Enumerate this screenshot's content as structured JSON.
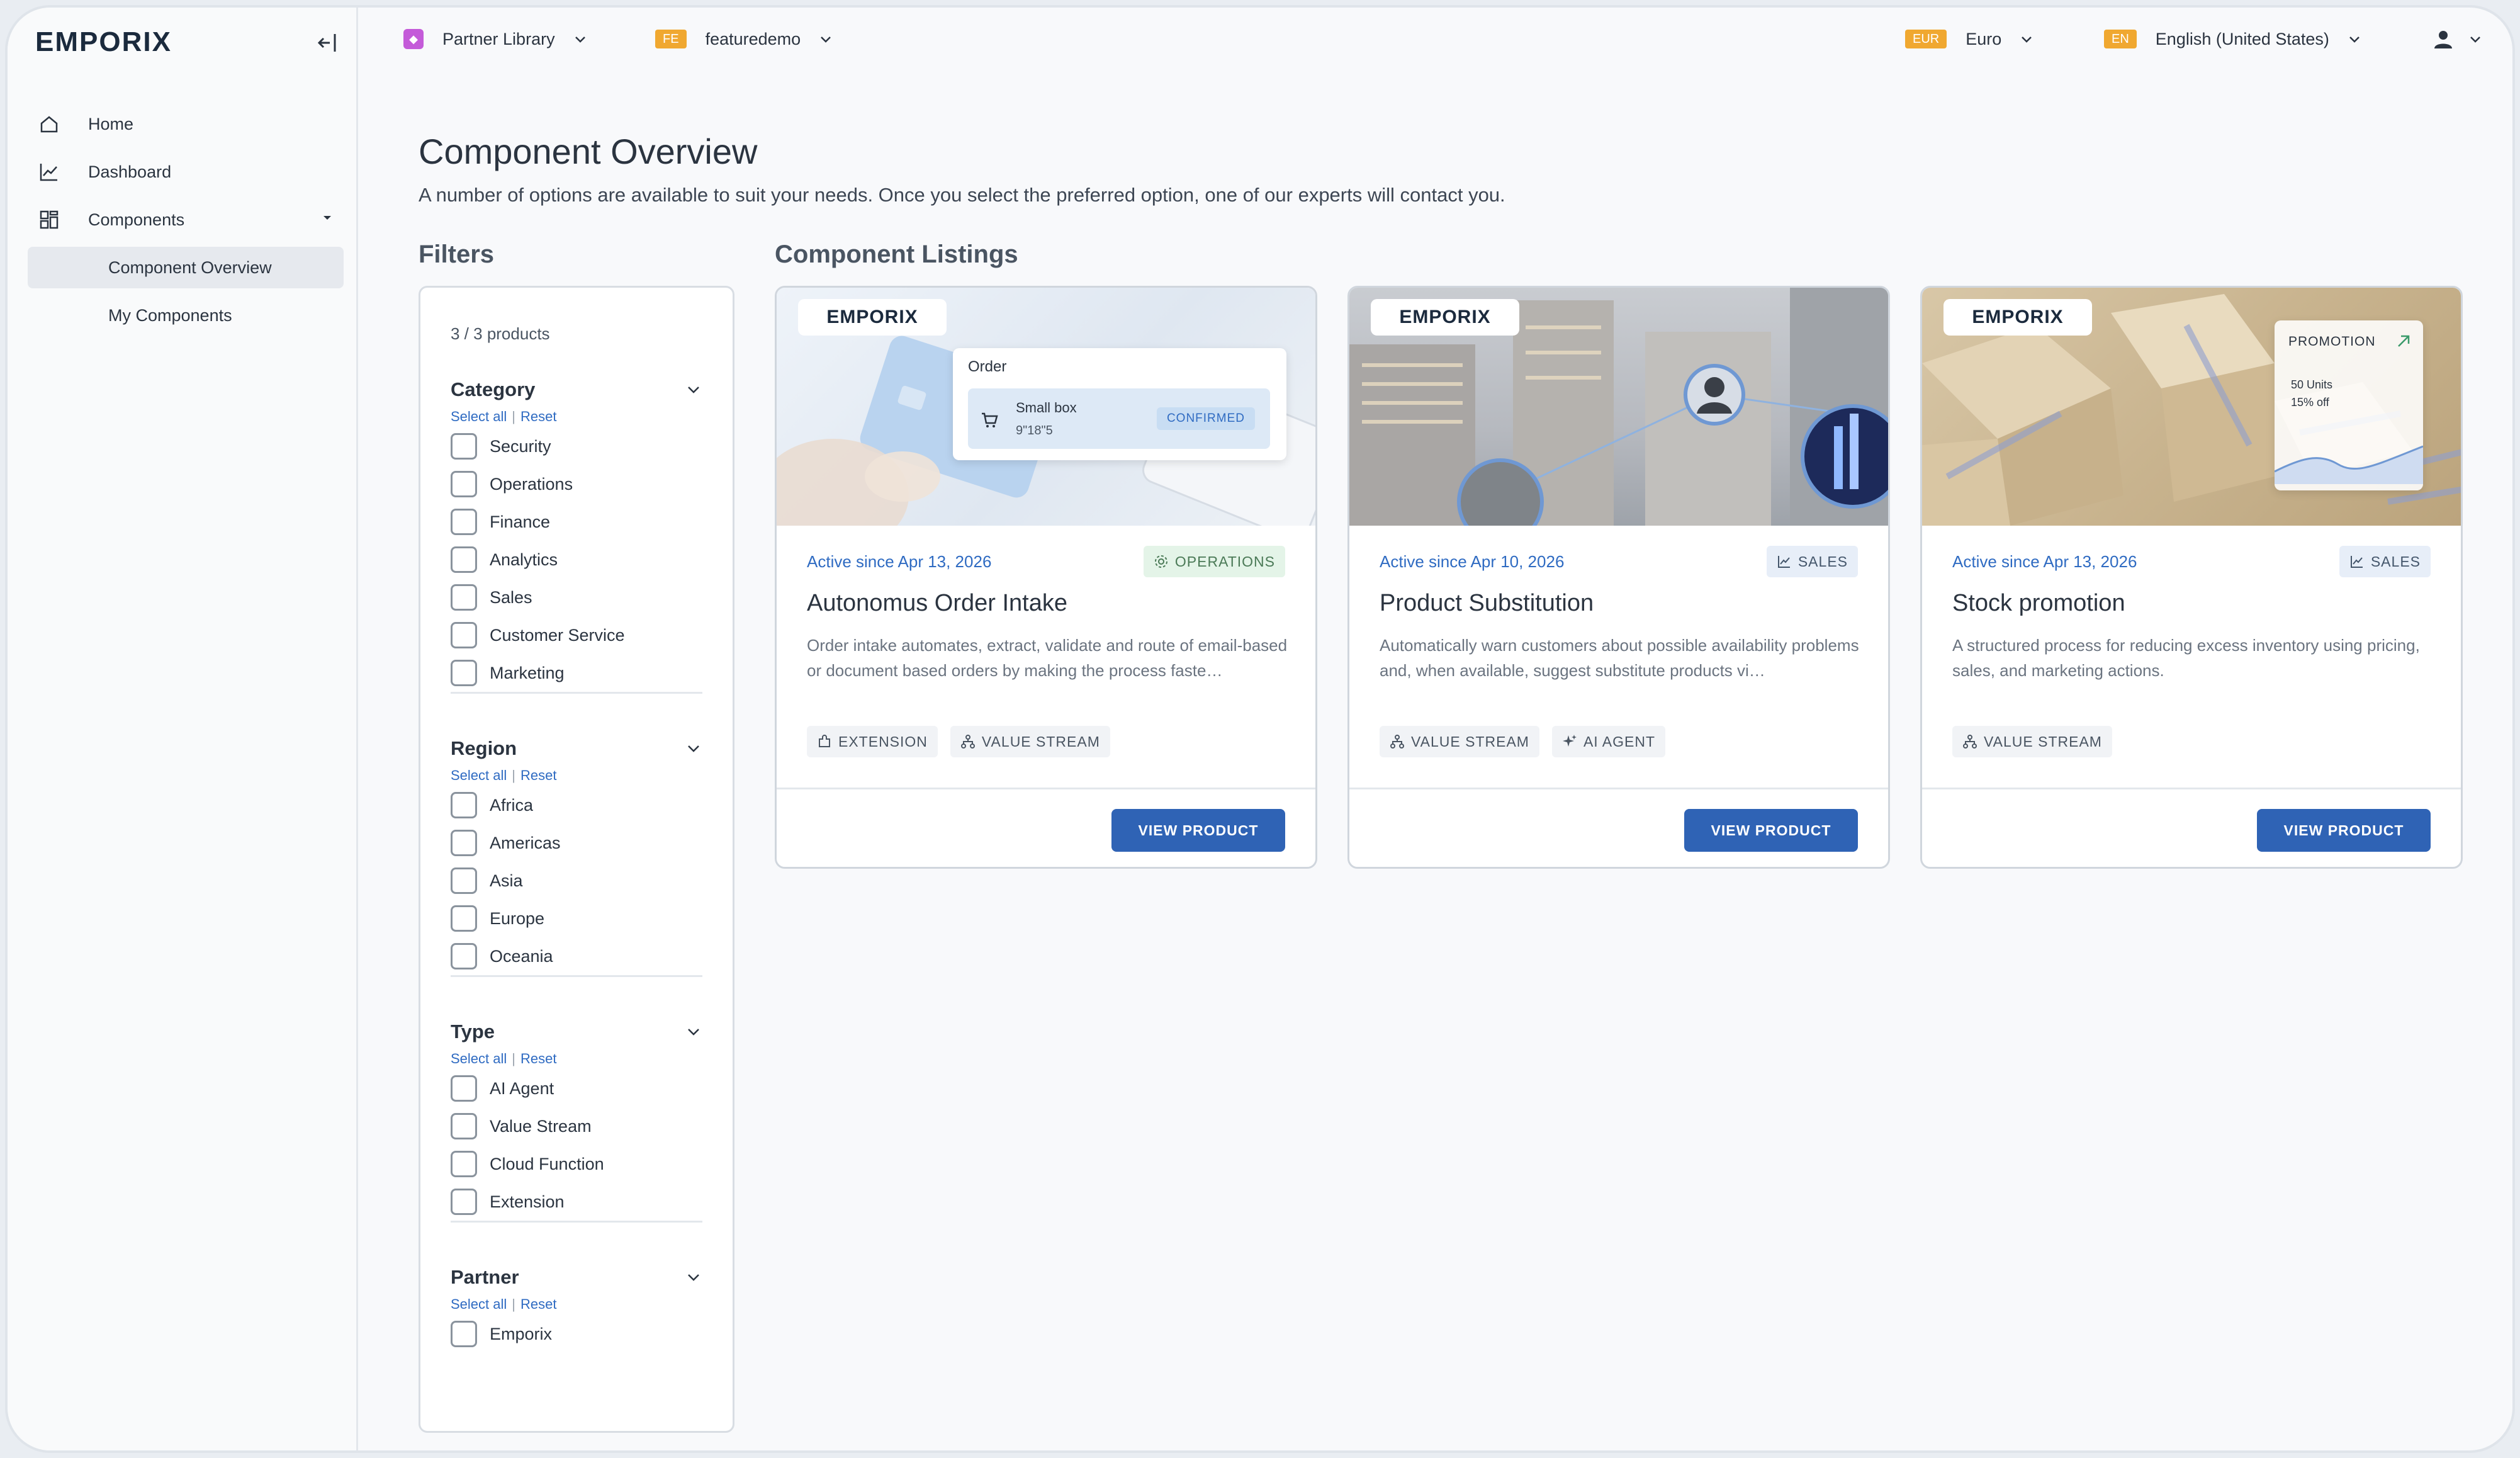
{
  "app": {
    "logo": "EMPORIX"
  },
  "sidebar": {
    "items": [
      {
        "label": "Home",
        "icon": "home-icon"
      },
      {
        "label": "Dashboard",
        "icon": "chart-line-icon"
      },
      {
        "label": "Components",
        "icon": "grid-icon"
      }
    ],
    "sub_items": [
      {
        "label": "Component Overview",
        "active": true
      },
      {
        "label": "My Components",
        "active": false
      }
    ]
  },
  "topbar": {
    "library": {
      "label": "Partner Library",
      "badge_color": "#c45bd9"
    },
    "tenant": {
      "badge": "FE",
      "label": "featuredemo"
    },
    "currency": {
      "badge": "EUR",
      "label": "Euro"
    },
    "language": {
      "badge": "EN",
      "label": "English (United States)"
    }
  },
  "page": {
    "title": "Component Overview",
    "subtitle": "A number of options are available to suit your needs. Once you select the preferred option, one of our experts will contact you.",
    "filters_title": "Filters",
    "listings_title": "Component Listings"
  },
  "filters": {
    "count": "3 / 3 products",
    "select_all": "Select all",
    "reset": "Reset",
    "groups": [
      {
        "title": "Category",
        "options": [
          "Security",
          "Operations",
          "Finance",
          "Analytics",
          "Sales",
          "Customer Service",
          "Marketing"
        ]
      },
      {
        "title": "Region",
        "options": [
          "Africa",
          "Americas",
          "Asia",
          "Europe",
          "Oceania"
        ]
      },
      {
        "title": "Type",
        "options": [
          "AI Agent",
          "Value Stream",
          "Cloud Function",
          "Extension"
        ]
      },
      {
        "title": "Partner",
        "options": [
          "Emporix"
        ]
      }
    ]
  },
  "cards": [
    {
      "logo": "EMPORIX",
      "active_since": "Active since Apr 13, 2026",
      "category": "OPERATIONS",
      "category_icon": "gear-icon",
      "category_colors": {
        "bg": "#e4f4e8",
        "fg": "#4b7a57"
      },
      "title": "Autonomus Order Intake",
      "description": "Order intake automates, extract, validate and route of email-based or document based orders by making the process faste…",
      "tags": [
        {
          "label": "EXTENSION",
          "icon": "puzzle-icon"
        },
        {
          "label": "VALUE STREAM",
          "icon": "flow-icon"
        }
      ],
      "button": "VIEW PRODUCT",
      "overlay": {
        "title": "Order",
        "item": "Small box",
        "size": "9\"18\"5",
        "status": "CONFIRMED"
      }
    },
    {
      "logo": "EMPORIX",
      "active_since": "Active since Apr 10, 2026",
      "category": "SALES",
      "category_icon": "chart-icon",
      "category_colors": {
        "bg": "#e7eef8",
        "fg": "#44566b"
      },
      "title": "Product Substitution",
      "description": "Automatically warn customers about possible availability problems and, when available, suggest substitute products vi…",
      "tags": [
        {
          "label": "VALUE STREAM",
          "icon": "flow-icon"
        },
        {
          "label": "AI AGENT",
          "icon": "sparkle-icon"
        }
      ],
      "button": "VIEW PRODUCT"
    },
    {
      "logo": "EMPORIX",
      "active_since": "Active since Apr 13, 2026",
      "category": "SALES",
      "category_icon": "chart-icon",
      "category_colors": {
        "bg": "#e7eef8",
        "fg": "#44566b"
      },
      "title": "Stock promotion",
      "description": "A structured process for reducing excess inventory using pricing, sales, and marketing actions.",
      "tags": [
        {
          "label": "VALUE STREAM",
          "icon": "flow-icon"
        }
      ],
      "button": "VIEW PRODUCT",
      "overlay": {
        "title": "PROMOTION",
        "line1": "50 Units",
        "line2": "15% off"
      }
    }
  ]
}
